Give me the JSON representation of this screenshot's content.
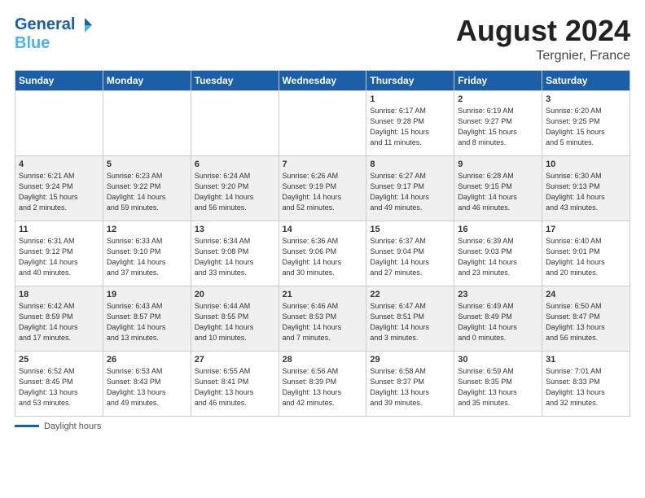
{
  "header": {
    "month": "August 2024",
    "location": "Tergnier, France",
    "logo_general": "General",
    "logo_blue": "Blue"
  },
  "days_of_week": [
    "Sunday",
    "Monday",
    "Tuesday",
    "Wednesday",
    "Thursday",
    "Friday",
    "Saturday"
  ],
  "footer": {
    "label": "Daylight hours"
  },
  "weeks": [
    [
      {
        "day": "",
        "info": ""
      },
      {
        "day": "",
        "info": ""
      },
      {
        "day": "",
        "info": ""
      },
      {
        "day": "",
        "info": ""
      },
      {
        "day": "1",
        "info": "Sunrise: 6:17 AM\nSunset: 9:28 PM\nDaylight: 15 hours\nand 11 minutes."
      },
      {
        "day": "2",
        "info": "Sunrise: 6:19 AM\nSunset: 9:27 PM\nDaylight: 15 hours\nand 8 minutes."
      },
      {
        "day": "3",
        "info": "Sunrise: 6:20 AM\nSunset: 9:25 PM\nDaylight: 15 hours\nand 5 minutes."
      }
    ],
    [
      {
        "day": "4",
        "info": "Sunrise: 6:21 AM\nSunset: 9:24 PM\nDaylight: 15 hours\nand 2 minutes."
      },
      {
        "day": "5",
        "info": "Sunrise: 6:23 AM\nSunset: 9:22 PM\nDaylight: 14 hours\nand 59 minutes."
      },
      {
        "day": "6",
        "info": "Sunrise: 6:24 AM\nSunset: 9:20 PM\nDaylight: 14 hours\nand 56 minutes."
      },
      {
        "day": "7",
        "info": "Sunrise: 6:26 AM\nSunset: 9:19 PM\nDaylight: 14 hours\nand 52 minutes."
      },
      {
        "day": "8",
        "info": "Sunrise: 6:27 AM\nSunset: 9:17 PM\nDaylight: 14 hours\nand 49 minutes."
      },
      {
        "day": "9",
        "info": "Sunrise: 6:28 AM\nSunset: 9:15 PM\nDaylight: 14 hours\nand 46 minutes."
      },
      {
        "day": "10",
        "info": "Sunrise: 6:30 AM\nSunset: 9:13 PM\nDaylight: 14 hours\nand 43 minutes."
      }
    ],
    [
      {
        "day": "11",
        "info": "Sunrise: 6:31 AM\nSunset: 9:12 PM\nDaylight: 14 hours\nand 40 minutes."
      },
      {
        "day": "12",
        "info": "Sunrise: 6:33 AM\nSunset: 9:10 PM\nDaylight: 14 hours\nand 37 minutes."
      },
      {
        "day": "13",
        "info": "Sunrise: 6:34 AM\nSunset: 9:08 PM\nDaylight: 14 hours\nand 33 minutes."
      },
      {
        "day": "14",
        "info": "Sunrise: 6:36 AM\nSunset: 9:06 PM\nDaylight: 14 hours\nand 30 minutes."
      },
      {
        "day": "15",
        "info": "Sunrise: 6:37 AM\nSunset: 9:04 PM\nDaylight: 14 hours\nand 27 minutes."
      },
      {
        "day": "16",
        "info": "Sunrise: 6:39 AM\nSunset: 9:03 PM\nDaylight: 14 hours\nand 23 minutes."
      },
      {
        "day": "17",
        "info": "Sunrise: 6:40 AM\nSunset: 9:01 PM\nDaylight: 14 hours\nand 20 minutes."
      }
    ],
    [
      {
        "day": "18",
        "info": "Sunrise: 6:42 AM\nSunset: 8:59 PM\nDaylight: 14 hours\nand 17 minutes."
      },
      {
        "day": "19",
        "info": "Sunrise: 6:43 AM\nSunset: 8:57 PM\nDaylight: 14 hours\nand 13 minutes."
      },
      {
        "day": "20",
        "info": "Sunrise: 6:44 AM\nSunset: 8:55 PM\nDaylight: 14 hours\nand 10 minutes."
      },
      {
        "day": "21",
        "info": "Sunrise: 6:46 AM\nSunset: 8:53 PM\nDaylight: 14 hours\nand 7 minutes."
      },
      {
        "day": "22",
        "info": "Sunrise: 6:47 AM\nSunset: 8:51 PM\nDaylight: 14 hours\nand 3 minutes."
      },
      {
        "day": "23",
        "info": "Sunrise: 6:49 AM\nSunset: 8:49 PM\nDaylight: 14 hours\nand 0 minutes."
      },
      {
        "day": "24",
        "info": "Sunrise: 6:50 AM\nSunset: 8:47 PM\nDaylight: 13 hours\nand 56 minutes."
      }
    ],
    [
      {
        "day": "25",
        "info": "Sunrise: 6:52 AM\nSunset: 8:45 PM\nDaylight: 13 hours\nand 53 minutes."
      },
      {
        "day": "26",
        "info": "Sunrise: 6:53 AM\nSunset: 8:43 PM\nDaylight: 13 hours\nand 49 minutes."
      },
      {
        "day": "27",
        "info": "Sunrise: 6:55 AM\nSunset: 8:41 PM\nDaylight: 13 hours\nand 46 minutes."
      },
      {
        "day": "28",
        "info": "Sunrise: 6:56 AM\nSunset: 8:39 PM\nDaylight: 13 hours\nand 42 minutes."
      },
      {
        "day": "29",
        "info": "Sunrise: 6:58 AM\nSunset: 8:37 PM\nDaylight: 13 hours\nand 39 minutes."
      },
      {
        "day": "30",
        "info": "Sunrise: 6:59 AM\nSunset: 8:35 PM\nDaylight: 13 hours\nand 35 minutes."
      },
      {
        "day": "31",
        "info": "Sunrise: 7:01 AM\nSunset: 8:33 PM\nDaylight: 13 hours\nand 32 minutes."
      }
    ]
  ]
}
